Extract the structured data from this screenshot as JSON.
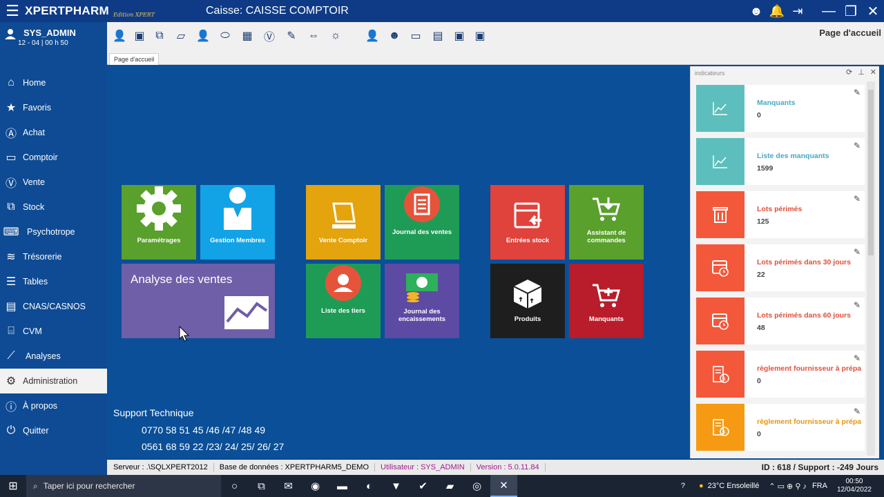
{
  "titlebar": {
    "app_name": "XPERTPHARM",
    "edition": "Edition XPERT",
    "caisse": "Caisse: CAISSE COMPTOIR"
  },
  "user": {
    "name": "SYS_ADMIN",
    "time": "12 - 04 | 00 h 50"
  },
  "sidebar": {
    "items": [
      {
        "label": "Home",
        "icon": "home-icon"
      },
      {
        "label": "Favoris",
        "icon": "star-icon"
      },
      {
        "label": "Achat",
        "icon": "achat-icon"
      },
      {
        "label": "Comptoir",
        "icon": "comptoir-icon"
      },
      {
        "label": "Vente",
        "icon": "vente-icon"
      },
      {
        "label": "Stock",
        "icon": "stock-icon"
      },
      {
        "label": "Psychotrope",
        "icon": "psychotrope-icon"
      },
      {
        "label": "Trésorerie",
        "icon": "tresorerie-icon"
      },
      {
        "label": "Tables",
        "icon": "tables-icon"
      },
      {
        "label": "CNAS/CASNOS",
        "icon": "cnas-icon"
      },
      {
        "label": "CVM",
        "icon": "cvm-icon"
      },
      {
        "label": "Analyses",
        "icon": "chart-icon"
      },
      {
        "label": "Administration",
        "icon": "gear-icon"
      },
      {
        "label": "À propos",
        "icon": "info-icon"
      },
      {
        "label": "Quitter",
        "icon": "power-icon"
      }
    ]
  },
  "toolbar": {
    "page_heading": "Page d'accueil"
  },
  "tabs": {
    "active": "Page d'accueil"
  },
  "tiles": {
    "parametrages": "Paramétrages",
    "gestion_membres": "Gestion Membres",
    "analyse_ventes": "Analyse des ventes",
    "vente_comptoir": "Vente Comptoir",
    "journal_ventes": "Journal des ventes",
    "liste_tiers": "Liste des tiers",
    "journal_encaissements_1": "Journal des",
    "journal_encaissements_2": "encaissements",
    "entrees_stock": "Entrées stock",
    "assistant_commandes_1": "Assistant de",
    "assistant_commandes_2": "commandes",
    "produits": "Produits",
    "manquants": "Manquants"
  },
  "support": {
    "title": "Support Technique",
    "phone1": "0770 58 51 45 /46 /47 /48 49",
    "phone2": "0561 68 59 22 /23/ 24/ 25/ 26/ 27"
  },
  "indicators": {
    "header": "indicateurs",
    "items": [
      {
        "title": "Manquants",
        "value": "0",
        "color": "#5cbfbd",
        "text_color": "#4aa8c0"
      },
      {
        "title": "Liste des manquants",
        "value": "1599",
        "color": "#5cbfbd",
        "text_color": "#4aa8c0"
      },
      {
        "title": "Lots périmés",
        "value": "125",
        "color": "#f4583a",
        "text_color": "#e0503a"
      },
      {
        "title": "Lots périmés dans 30 jours",
        "value": "22",
        "color": "#f4583a",
        "text_color": "#e0503a"
      },
      {
        "title": "Lots périmés dans 60 jours",
        "value": "48",
        "color": "#f4583a",
        "text_color": "#e0503a"
      },
      {
        "title": "règlement fournisseur à prépa",
        "value": "0",
        "color": "#f4583a",
        "text_color": "#e0503a"
      },
      {
        "title": "règlement fournisseur à prépa",
        "value": "0",
        "color": "#f59a12",
        "text_color": "#e8950f"
      }
    ]
  },
  "statusbar": {
    "server": "Serveur : .\\SQLXPERT2012",
    "database": "Base de données : XPERTPHARM5_DEMO",
    "user": "Utilisateur : SYS_ADMIN",
    "version": "Version : 5.0.11.84",
    "id_support": "ID : 618 / Support : -249 Jours"
  },
  "taskbar": {
    "search_placeholder": "Taper ici pour rechercher",
    "weather": "23°C  Ensoleillé",
    "lang": "FRA",
    "time": "00:50",
    "date": "12/04/2022"
  }
}
